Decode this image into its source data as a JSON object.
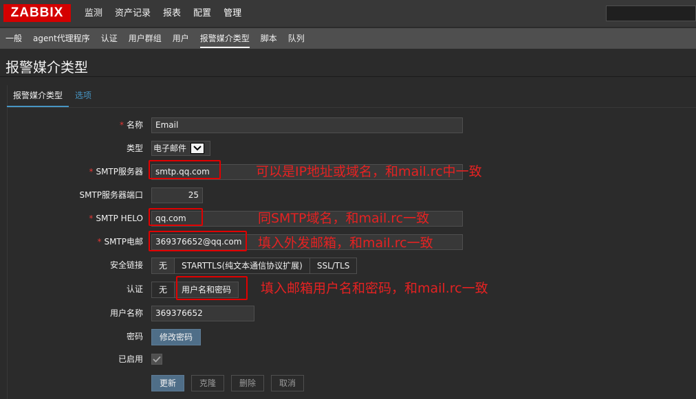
{
  "app": {
    "logo": "ZABBIX"
  },
  "main_nav": [
    {
      "label": "监测"
    },
    {
      "label": "资产记录"
    },
    {
      "label": "报表"
    },
    {
      "label": "配置"
    },
    {
      "label": "管理"
    }
  ],
  "sub_nav": [
    {
      "label": "一般"
    },
    {
      "label": "agent代理程序"
    },
    {
      "label": "认证"
    },
    {
      "label": "用户群组"
    },
    {
      "label": "用户"
    },
    {
      "label": "报警媒介类型"
    },
    {
      "label": "脚本"
    },
    {
      "label": "队列"
    }
  ],
  "page_title": "报警媒介类型",
  "tabs": [
    {
      "label": "报警媒介类型"
    },
    {
      "label": "选项"
    }
  ],
  "form": {
    "name": {
      "label": "名称",
      "value": "Email"
    },
    "type": {
      "label": "类型",
      "value": "电子邮件"
    },
    "smtp_server": {
      "label": "SMTP服务器",
      "value": "smtp.qq.com"
    },
    "smtp_port": {
      "label": "SMTP服务器端口",
      "value": "25"
    },
    "smtp_helo": {
      "label": "SMTP HELO",
      "value": "qq.com"
    },
    "smtp_email": {
      "label": "SMTP电邮",
      "value": "369376652@qq.com"
    },
    "security": {
      "label": "安全链接",
      "options": [
        "无",
        "STARTTLS(纯文本通信协议扩展)",
        "SSL/TLS"
      ],
      "selected": "无"
    },
    "auth": {
      "label": "认证",
      "options": [
        "无",
        "用户名和密码"
      ],
      "selected": "用户名和密码"
    },
    "username": {
      "label": "用户名称",
      "value": "369376652"
    },
    "password": {
      "label": "密码",
      "button": "修改密码"
    },
    "enabled": {
      "label": "已启用",
      "checked": true
    }
  },
  "buttons": {
    "update": "更新",
    "clone": "克隆",
    "delete": "删除",
    "cancel": "取消"
  },
  "annotations": {
    "smtp_server": "可以是IP地址或域名，和mail.rc中一致",
    "smtp_helo": "同SMTP域名，和mail.rc一致",
    "smtp_email": "填入外发邮箱，和mail.rc一致",
    "auth": "填入邮箱用户名和密码，和mail.rc一致"
  },
  "colors": {
    "accent": "#4796c4",
    "brand": "#d40000",
    "annotation": "#e20000",
    "required": "#e33734"
  }
}
